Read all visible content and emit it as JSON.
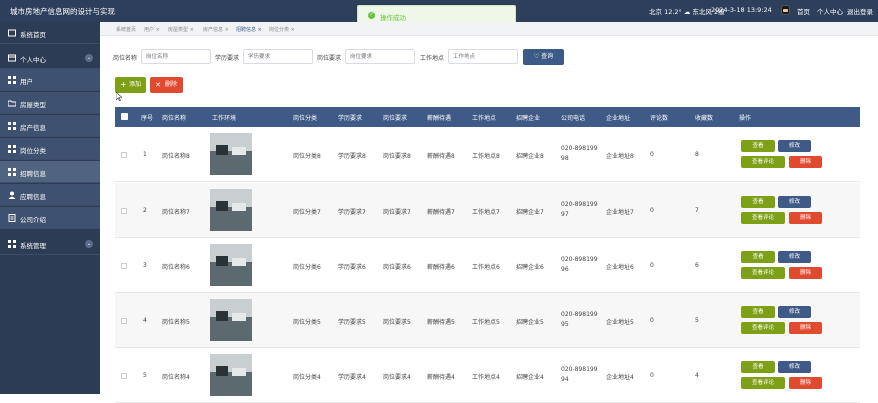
{
  "header": {
    "title": "城市房地产信息网的设计与实现",
    "weather": "北京   12.2°  ☁ 东北风 2级",
    "datetime": "2024-3-18 13:9:24",
    "links": [
      "首页",
      "个人中心",
      "退出登录"
    ]
  },
  "toast": {
    "text": "操作成功"
  },
  "sidebar": {
    "items": [
      {
        "label": "系统首页",
        "icon": "home-icon",
        "arrow": false
      },
      {
        "label": "个人中心",
        "icon": "user-card-icon",
        "arrow": true
      },
      {
        "label": "用户",
        "icon": "grid-icon",
        "arrow": false
      },
      {
        "label": "房屋类型",
        "icon": "folder-icon",
        "arrow": false
      },
      {
        "label": "房产信息",
        "icon": "grid-icon",
        "arrow": false
      },
      {
        "label": "岗位分类",
        "icon": "grid-icon",
        "arrow": false
      },
      {
        "label": "招聘信息",
        "icon": "grid-icon",
        "arrow": false
      },
      {
        "label": "应聘信息",
        "icon": "person-icon",
        "arrow": false
      },
      {
        "label": "公司介绍",
        "icon": "document-icon",
        "arrow": false
      },
      {
        "label": "系统管理",
        "icon": "grid-icon",
        "arrow": true
      }
    ]
  },
  "breadcrumb": [
    "系统首页",
    "用户 ×",
    "房屋类型 ×",
    "房产信息 ×",
    "招聘信息 ×",
    "岗位分类 ×"
  ],
  "search": {
    "fields": [
      {
        "label": "岗位名称",
        "placeholder": "岗位名称"
      },
      {
        "label": "学历要求",
        "placeholder": "学历要求"
      },
      {
        "label": "岗位要求",
        "placeholder": "岗位要求"
      },
      {
        "label": "工作地点",
        "placeholder": "工作地点"
      }
    ],
    "button": "♡ 查询"
  },
  "actions": {
    "add": "添加",
    "delete": "删除"
  },
  "table": {
    "headers": [
      "序号",
      "岗位名称",
      "工作环境",
      "岗位分类",
      "学历要求",
      "岗位要求",
      "薪酬待遇",
      "工作地点",
      "招聘企业",
      "公司电话",
      "企业地址",
      "评论数",
      "收藏数",
      "操作"
    ],
    "rows": [
      {
        "index": "1",
        "name": "岗位名称8",
        "category": "岗位分类8",
        "education": "学历要求8",
        "requirement": "岗位要求8",
        "salary": "薪酬待遇8",
        "location": "工作地点8",
        "company": "招聘企业8",
        "phone1": "020-898199",
        "phone2": "98",
        "address": "企业地址8",
        "comments": "0",
        "favorites": "8"
      },
      {
        "index": "2",
        "name": "岗位名称7",
        "category": "岗位分类7",
        "education": "学历要求7",
        "requirement": "岗位要求7",
        "salary": "薪酬待遇7",
        "location": "工作地点7",
        "company": "招聘企业7",
        "phone1": "020-898199",
        "phone2": "97",
        "address": "企业地址7",
        "comments": "0",
        "favorites": "7"
      },
      {
        "index": "3",
        "name": "岗位名称6",
        "category": "岗位分类6",
        "education": "学历要求6",
        "requirement": "岗位要求6",
        "salary": "薪酬待遇6",
        "location": "工作地点6",
        "company": "招聘企业6",
        "phone1": "020-898199",
        "phone2": "96",
        "address": "企业地址6",
        "comments": "0",
        "favorites": "6"
      },
      {
        "index": "4",
        "name": "岗位名称5",
        "category": "岗位分类5",
        "education": "学历要求5",
        "requirement": "岗位要求5",
        "salary": "薪酬待遇5",
        "location": "工作地点5",
        "company": "招聘企业5",
        "phone1": "020-898199",
        "phone2": "95",
        "address": "企业地址5",
        "comments": "0",
        "favorites": "5"
      },
      {
        "index": "5",
        "name": "岗位名称4",
        "category": "岗位分类4",
        "education": "学历要求4",
        "requirement": "岗位要求4",
        "salary": "薪酬待遇4",
        "location": "工作地点4",
        "company": "招聘企业4",
        "phone1": "020-898199",
        "phone2": "94",
        "address": "企业地址4",
        "comments": "0",
        "favorites": "4"
      }
    ],
    "row_buttons": {
      "view": "查看",
      "edit": "修改",
      "review": "查看评论",
      "remove": "删除"
    }
  },
  "colors": {
    "topbar": "#2e3f5c",
    "sidebar": "#2d3c55",
    "table_header": "#3f5a86",
    "green": "#7ea016",
    "red": "#e04a2e"
  }
}
